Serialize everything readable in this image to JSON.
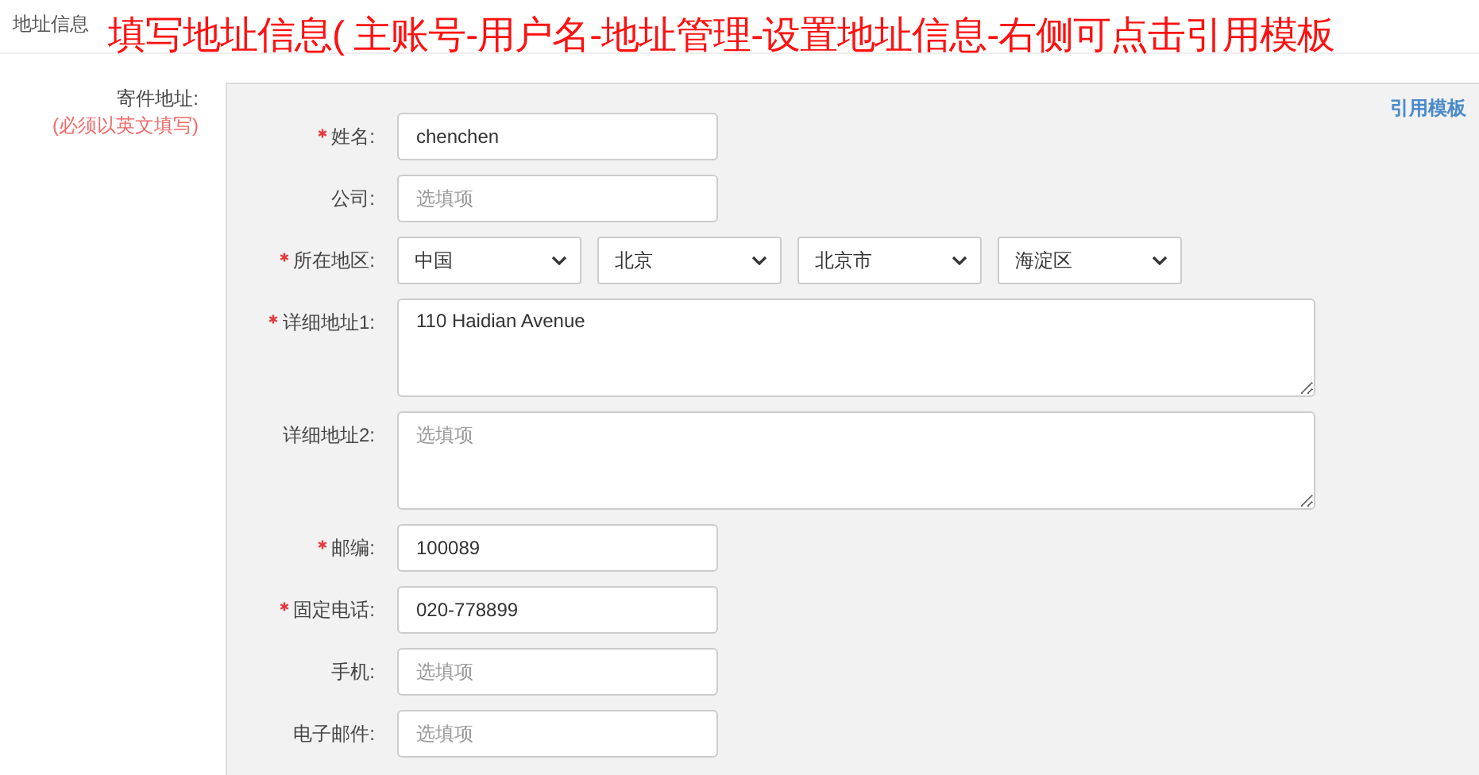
{
  "header": {
    "tab": "地址信息"
  },
  "annotation": "填写地址信息( 主账号-用户名-地址管理-设置地址信息-右侧可点击引用模板",
  "section": {
    "label": "寄件地址:",
    "note": "(必须以英文填写)"
  },
  "template_link": "引用模板",
  "fields": [
    {
      "kind": "text",
      "label": "姓名:",
      "required": true,
      "value": "chenchen"
    },
    {
      "kind": "text",
      "label": "公司:",
      "required": false,
      "placeholder": "选填项"
    },
    {
      "kind": "select",
      "label": "所在地区:",
      "required": true,
      "options": [
        "中国",
        "北京",
        "北京市",
        "海淀区"
      ]
    },
    {
      "kind": "textarea",
      "label": "详细地址1:",
      "required": true,
      "value": "110 Haidian Avenue"
    },
    {
      "kind": "textarea",
      "label": "详细地址2:",
      "required": false,
      "placeholder": "选填项"
    },
    {
      "kind": "text",
      "label": "邮编:",
      "required": true,
      "value": "100089"
    },
    {
      "kind": "text",
      "label": "固定电话:",
      "required": true,
      "value": "020-778899"
    },
    {
      "kind": "text",
      "label": "手机:",
      "required": false,
      "placeholder": "选填项"
    },
    {
      "kind": "text",
      "label": "电子邮件:",
      "required": false,
      "placeholder": "选填项"
    }
  ]
}
